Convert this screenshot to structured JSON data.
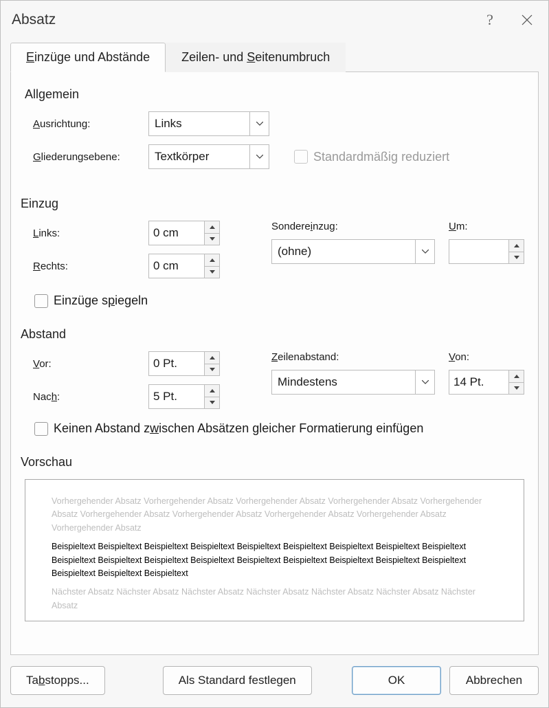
{
  "title": "Absatz",
  "tabs": {
    "indents": {
      "pre": "E",
      "rest": "inzüge und Abstände"
    },
    "breaks": {
      "left": "Zeilen- und ",
      "pre": "S",
      "rest": "eitenumbruch"
    }
  },
  "general": {
    "title": "Allgemein",
    "alignment_label_pre": "A",
    "alignment_label_rest": "usrichtung:",
    "alignment_value": "Links",
    "outline_label_pre": "G",
    "outline_label_rest": "liederungsebene:",
    "outline_value": "Textkörper",
    "collapse_label": "Standardmäßig reduziert"
  },
  "indent": {
    "title": "Einzug",
    "left_label_pre": "L",
    "left_label_rest": "inks:",
    "left_value": "0 cm",
    "right_label_pre": "R",
    "right_label_rest": "echts:",
    "right_value": "0 cm",
    "special_label_pre": "Sondere",
    "special_label_u": "i",
    "special_label_rest": "nzug:",
    "special_value": "(ohne)",
    "by_label_pre": "U",
    "by_label_rest": "m:",
    "by_value": "",
    "mirror_label_pre": "Einzüge s",
    "mirror_label_u": "p",
    "mirror_label_rest": "iegeln"
  },
  "spacing": {
    "title": "Abstand",
    "before_label_pre": "V",
    "before_label_rest": "or:",
    "before_value": "0 Pt.",
    "after_label": "Nac",
    "after_label_u": "h",
    "after_label_rest": ":",
    "after_value": "5 Pt.",
    "line_label_pre": "Z",
    "line_label_rest": "eilenabstand:",
    "line_value": "Mindestens",
    "at_label_pre": "V",
    "at_label_rest": "on:",
    "at_value": "14 Pt.",
    "nosame_pre": "Keinen Abstand z",
    "nosame_u": "w",
    "nosame_rest": "ischen Absätzen gleicher Formatierung einfügen"
  },
  "preview": {
    "title": "Vorschau",
    "prev_para": "Vorhergehender Absatz Vorhergehender Absatz Vorhergehender Absatz Vorhergehender Absatz Vorhergehender Absatz Vorhergehender Absatz Vorhergehender Absatz Vorhergehender Absatz Vorhergehender Absatz Vorhergehender Absatz",
    "sample": "Beispieltext Beispieltext Beispieltext Beispieltext Beispieltext Beispieltext Beispieltext Beispieltext Beispieltext Beispieltext Beispieltext Beispieltext Beispieltext Beispieltext Beispieltext Beispieltext Beispieltext Beispieltext Beispieltext Beispieltext Beispieltext",
    "next_para": "Nächster Absatz Nächster Absatz Nächster Absatz Nächster Absatz Nächster Absatz Nächster Absatz Nächster Absatz"
  },
  "footer": {
    "tabs_btn_pre": "Ta",
    "tabs_btn_u": "b",
    "tabs_btn_rest": "stopps...",
    "default_btn": "Als Standard festlegen",
    "ok": "OK",
    "cancel": "Abbrechen"
  }
}
